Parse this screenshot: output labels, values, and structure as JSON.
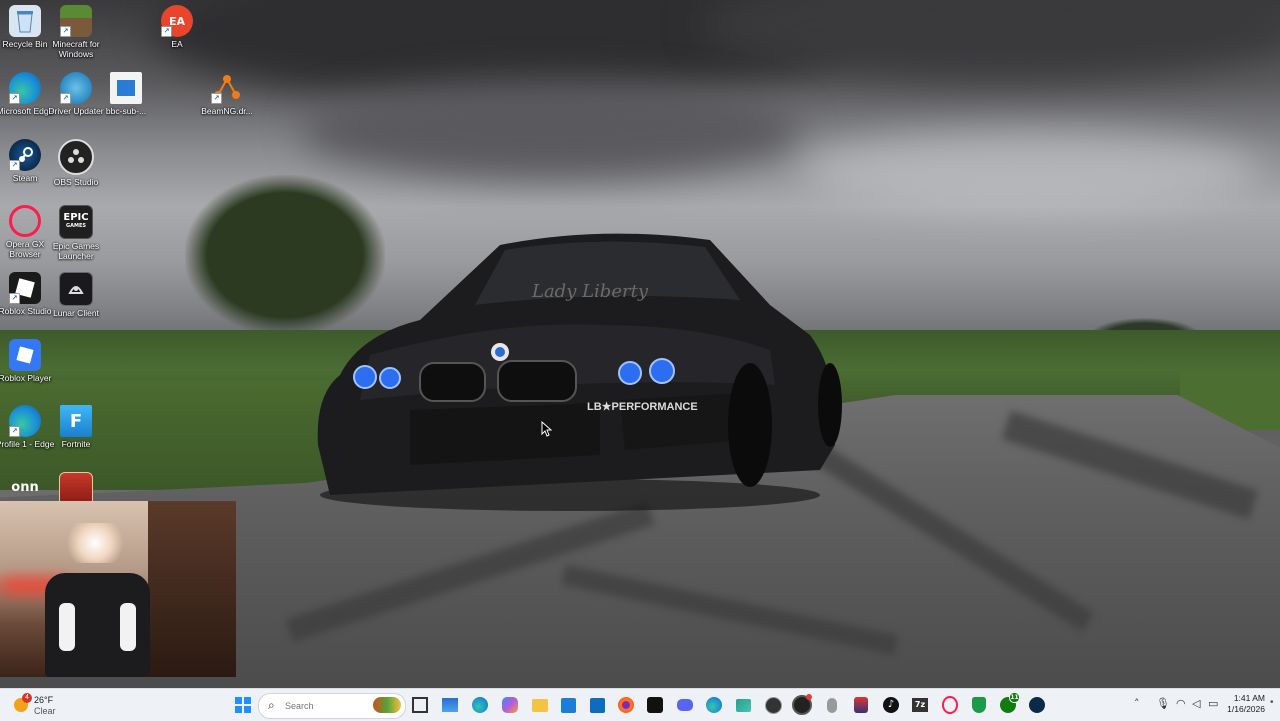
{
  "desktop": {
    "icons": [
      {
        "label": "Recycle Bin",
        "icon": "recycle-bin-icon"
      },
      {
        "label": "Minecraft for Windows",
        "icon": "minecraft-icon"
      },
      {
        "label": "EA",
        "icon": "ea-icon"
      },
      {
        "label": "Microsoft Edge",
        "icon": "edge-icon"
      },
      {
        "label": "Driver Updater",
        "icon": "driver-updater-icon"
      },
      {
        "label": "bbc-sub-...",
        "icon": "file-icon"
      },
      {
        "label": "BeamNG.dr...",
        "icon": "beamng-icon"
      },
      {
        "label": "Steam",
        "icon": "steam-icon"
      },
      {
        "label": "OBS Studio",
        "icon": "obs-icon"
      },
      {
        "label": "Opera GX Browser",
        "icon": "opera-gx-icon"
      },
      {
        "label": "Epic Games Launcher",
        "icon": "epic-games-icon"
      },
      {
        "label": "Roblox Studio",
        "icon": "roblox-studio-icon"
      },
      {
        "label": "Lunar Client",
        "icon": "lunar-client-icon"
      },
      {
        "label": "Roblox Player",
        "icon": "roblox-player-icon"
      },
      {
        "label": "Profile 1 - Edge",
        "icon": "edge-profile-icon"
      },
      {
        "label": "Fortnite",
        "icon": "fortnite-icon"
      },
      {
        "label": "onn",
        "icon": "onn-icon"
      },
      {
        "label": "",
        "icon": "game-thumbnail-icon"
      }
    ],
    "epic_icon_text": "EPIC",
    "epic_icon_subtext": "GAMES",
    "ea_icon_text": "EA",
    "fortnite_icon_text": "F",
    "onn_icon_text": "onn",
    "car_badges": {
      "windshield": "Lady Liberty",
      "bumper": "LB★PERFORMANCE"
    }
  },
  "taskbar": {
    "weather": {
      "temperature": "26°F",
      "condition": "Clear",
      "badge": "4"
    },
    "search": {
      "placeholder": "Search"
    },
    "apps": [
      {
        "name": "start-button",
        "icon": "windows-logo-icon"
      },
      {
        "name": "task-view",
        "icon": "task-view-icon"
      },
      {
        "name": "widgets",
        "icon": "widgets-icon"
      },
      {
        "name": "edge",
        "icon": "edge-icon"
      },
      {
        "name": "copilot",
        "icon": "copilot-icon"
      },
      {
        "name": "file-explorer",
        "icon": "folder-icon"
      },
      {
        "name": "store",
        "icon": "store-icon"
      },
      {
        "name": "outlook",
        "icon": "outlook-icon"
      },
      {
        "name": "firefox",
        "icon": "firefox-icon"
      },
      {
        "name": "capcut",
        "icon": "capcut-icon"
      },
      {
        "name": "discord",
        "icon": "discord-icon"
      },
      {
        "name": "edge-profile",
        "icon": "edge-icon"
      },
      {
        "name": "photos",
        "icon": "photos-icon"
      },
      {
        "name": "obs",
        "icon": "obs-icon"
      },
      {
        "name": "mouse-app",
        "icon": "mouse-icon"
      },
      {
        "name": "app-rocket",
        "icon": "rocket-icon"
      },
      {
        "name": "tiktok",
        "icon": "tiktok-icon"
      },
      {
        "name": "7zip",
        "icon": "7zip-icon"
      },
      {
        "name": "opera-gx",
        "icon": "opera-gx-icon"
      },
      {
        "name": "shield-app",
        "icon": "shield-icon"
      },
      {
        "name": "xbox",
        "icon": "xbox-icon"
      },
      {
        "name": "steam",
        "icon": "steam-icon"
      }
    ],
    "xbox_badge": "11",
    "seven_zip_text": "7z",
    "clock": {
      "time": "1:41 AM",
      "date": "1/16/2026"
    }
  }
}
